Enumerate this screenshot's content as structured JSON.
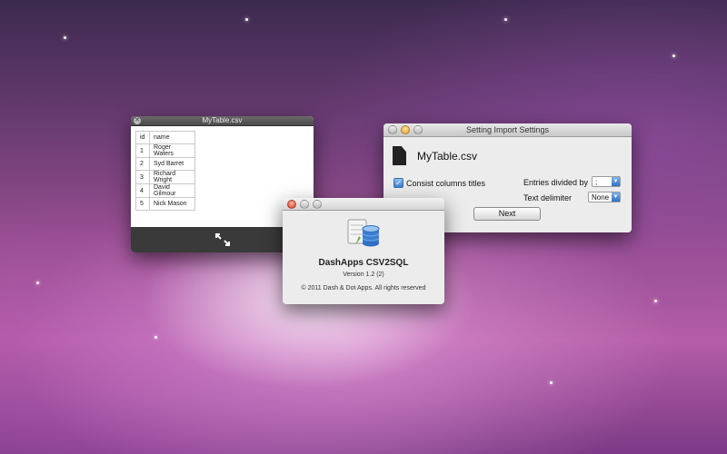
{
  "table_window": {
    "title": "MyTable.csv",
    "headers": [
      "id",
      "name"
    ],
    "rows": [
      [
        "1",
        "Roger Waters"
      ],
      [
        "2",
        "Syd Barret"
      ],
      [
        "3",
        "Richard Wright"
      ],
      [
        "4",
        "David Gilmour"
      ],
      [
        "5",
        "Nick Mason"
      ]
    ],
    "icons": [
      "close-icon",
      "resize-icon"
    ]
  },
  "settings_window": {
    "title": "Setting Import Settings",
    "file_name": "MyTable.csv",
    "consist_columns_label": "Consist columns titles",
    "consist_columns_checked": true,
    "entries_label": "Entries divided by",
    "entries_value": ";",
    "delimiter_label": "Text delimiter",
    "delimiter_value": "None",
    "next_label": "Next"
  },
  "about_window": {
    "app_name": "DashApps CSV2SQL",
    "version": "Version 1.2 (2)",
    "copyright": "© 2011 Dash & Dot Apps. All rights reserved"
  },
  "colors": {
    "accent": "#3c7fd0",
    "close_red": "#d83820",
    "minimize_orange": "#e8a020"
  }
}
